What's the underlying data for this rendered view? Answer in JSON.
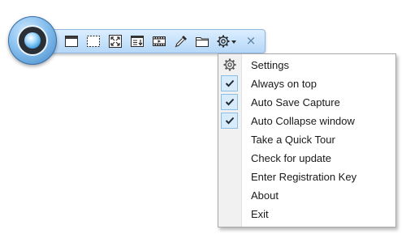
{
  "toolbar": {
    "buttons": [
      {
        "name": "window-capture",
        "icon": "window-icon"
      },
      {
        "name": "region-capture",
        "icon": "dashed-rectangle-icon"
      },
      {
        "name": "fullscreen-capture",
        "icon": "fullscreen-icon"
      },
      {
        "name": "scrolling-capture",
        "icon": "scroll-window-icon"
      },
      {
        "name": "video-capture",
        "icon": "film-icon"
      },
      {
        "name": "color-picker",
        "icon": "eyedropper-icon"
      },
      {
        "name": "open-folder",
        "icon": "folder-icon"
      },
      {
        "name": "settings-dropdown",
        "icon": "gear-dropdown-icon"
      }
    ],
    "close_glyph": "×",
    "accent_color": "#b5d7f7"
  },
  "menu": {
    "items": [
      {
        "label": "Settings",
        "marker": "gear"
      },
      {
        "label": "Always on top",
        "marker": "check"
      },
      {
        "label": "Auto Save Capture",
        "marker": "check"
      },
      {
        "label": "Auto Collapse window",
        "marker": "check"
      },
      {
        "label": "Take a Quick Tour",
        "marker": "none"
      },
      {
        "label": "Check for update",
        "marker": "none"
      },
      {
        "label": "Enter Registration Key",
        "marker": "none"
      },
      {
        "label": "About",
        "marker": "none"
      },
      {
        "label": "Exit",
        "marker": "none"
      }
    ]
  }
}
